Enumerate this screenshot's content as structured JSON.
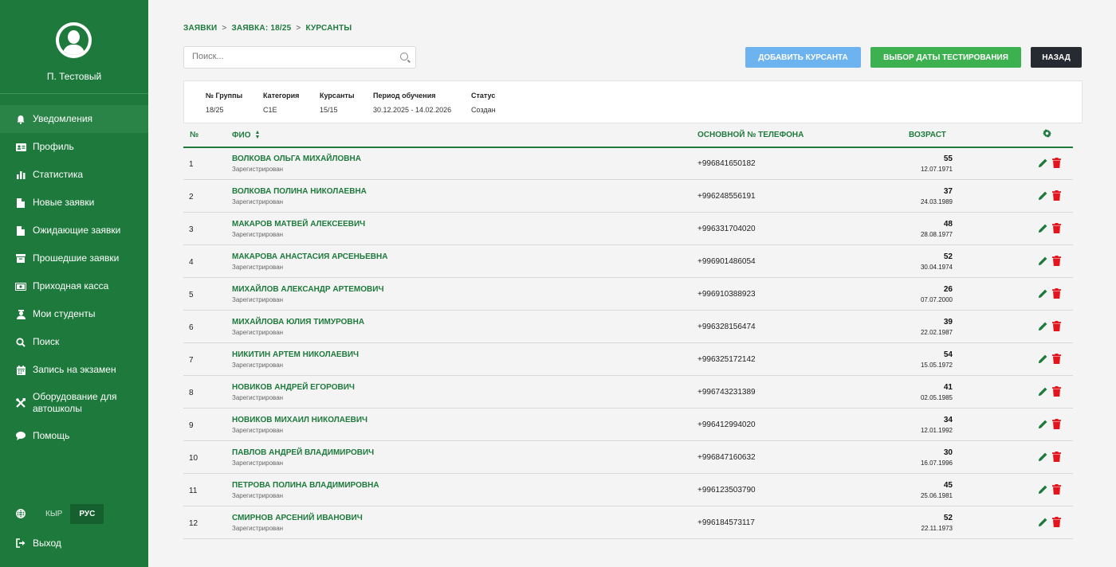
{
  "sidebar": {
    "username": "П. Тестовый",
    "items": [
      {
        "label": "Уведомления",
        "icon": "bell-icon"
      },
      {
        "label": "Профиль",
        "icon": "id-card-icon"
      },
      {
        "label": "Статистика",
        "icon": "bar-chart-icon"
      },
      {
        "label": "Новые заявки",
        "icon": "file-icon"
      },
      {
        "label": "Ожидающие заявки",
        "icon": "file-icon"
      },
      {
        "label": "Прошедшие заявки",
        "icon": "archive-icon"
      },
      {
        "label": "Приходная касса",
        "icon": "money-icon"
      },
      {
        "label": "Мои студенты",
        "icon": "graduate-icon"
      },
      {
        "label": "Поиск",
        "icon": "search-icon"
      },
      {
        "label": "Запись на экзамен",
        "icon": "calendar-icon"
      },
      {
        "label": "Оборудование для автошколы",
        "icon": "tools-icon"
      },
      {
        "label": "Помощь",
        "icon": "chat-icon"
      }
    ],
    "lang": {
      "kyr": "КЫР",
      "rus": "РУС"
    },
    "logout": "Выход"
  },
  "breadcrumb": {
    "item1": "ЗАЯВКИ",
    "item2": "ЗАЯВКА: 18/25",
    "item3": "КУРСАНТЫ",
    "sep": ">"
  },
  "search": {
    "placeholder": "Поиск..."
  },
  "buttons": {
    "add": "ДОБАВИТЬ КУРСАНТА",
    "date": "ВЫБОР ДАТЫ ТЕСТИРОВАНИЯ",
    "back": "НАЗАД"
  },
  "info": {
    "group_label": "№ Группы",
    "group": "18/25",
    "category_label": "Категория",
    "category": "C1E",
    "cadets_label": "Курсанты",
    "cadets": "15/15",
    "period_label": "Период обучения",
    "period": "30.12.2025 - 14.02.2026",
    "status_label": "Статус",
    "status": "Создан"
  },
  "table": {
    "headers": {
      "num": "№",
      "name": "ФИО",
      "phone": "ОСНОВНОЙ № ТЕЛЕФОНА",
      "age": "ВОЗРАСТ"
    },
    "rows": [
      {
        "num": "1",
        "name": "ВОЛКОВА ОЛЬГА МИХАЙЛОВНА",
        "status": "Зарегистрирован",
        "phone": "+996841650182",
        "age": "55",
        "dob": "12.07.1971"
      },
      {
        "num": "2",
        "name": "ВОЛКОВА ПОЛИНА НИКОЛАЕВНА",
        "status": "Зарегистрирован",
        "phone": "+996248556191",
        "age": "37",
        "dob": "24.03.1989"
      },
      {
        "num": "3",
        "name": "МАКАРОВ МАТВЕЙ АЛЕКСЕЕВИЧ",
        "status": "Зарегистрирован",
        "phone": "+996331704020",
        "age": "48",
        "dob": "28.08.1977"
      },
      {
        "num": "4",
        "name": "МАКАРОВА АНАСТАСИЯ АРСЕНЬЕВНА",
        "status": "Зарегистрирован",
        "phone": "+996901486054",
        "age": "52",
        "dob": "30.04.1974"
      },
      {
        "num": "5",
        "name": "МИХАЙЛОВ АЛЕКСАНДР АРТЕМОВИЧ",
        "status": "Зарегистрирован",
        "phone": "+996910388923",
        "age": "26",
        "dob": "07.07.2000"
      },
      {
        "num": "6",
        "name": "МИХАЙЛОВА ЮЛИЯ ТИМУРОВНА",
        "status": "Зарегистрирован",
        "phone": "+996328156474",
        "age": "39",
        "dob": "22.02.1987"
      },
      {
        "num": "7",
        "name": "НИКИТИН АРТЕМ НИКОЛАЕВИЧ",
        "status": "Зарегистрирован",
        "phone": "+996325172142",
        "age": "54",
        "dob": "15.05.1972"
      },
      {
        "num": "8",
        "name": "НОВИКОВ АНДРЕЙ ЕГОРОВИЧ",
        "status": "Зарегистрирован",
        "phone": "+996743231389",
        "age": "41",
        "dob": "02.05.1985"
      },
      {
        "num": "9",
        "name": "НОВИКОВ МИХАИЛ НИКОЛАЕВИЧ",
        "status": "Зарегистрирован",
        "phone": "+996412994020",
        "age": "34",
        "dob": "12.01.1992"
      },
      {
        "num": "10",
        "name": "ПАВЛОВ АНДРЕЙ ВЛАДИМИРОВИЧ",
        "status": "Зарегистрирован",
        "phone": "+996847160632",
        "age": "30",
        "dob": "16.07.1996"
      },
      {
        "num": "11",
        "name": "ПЕТРОВА ПОЛИНА ВЛАДИМИРОВНА",
        "status": "Зарегистрирован",
        "phone": "+996123503790",
        "age": "45",
        "dob": "25.06.1981"
      },
      {
        "num": "12",
        "name": "СМИРНОВ АРСЕНИЙ ИВАНОВИЧ",
        "status": "Зарегистрирован",
        "phone": "+996184573117",
        "age": "52",
        "dob": "22.11.1973"
      }
    ]
  },
  "colors": {
    "brand": "#1e7a3c",
    "add_button": "#6cb3ef",
    "date_button": "#3db050",
    "back_button": "#262a31",
    "delete": "#e3141b"
  }
}
